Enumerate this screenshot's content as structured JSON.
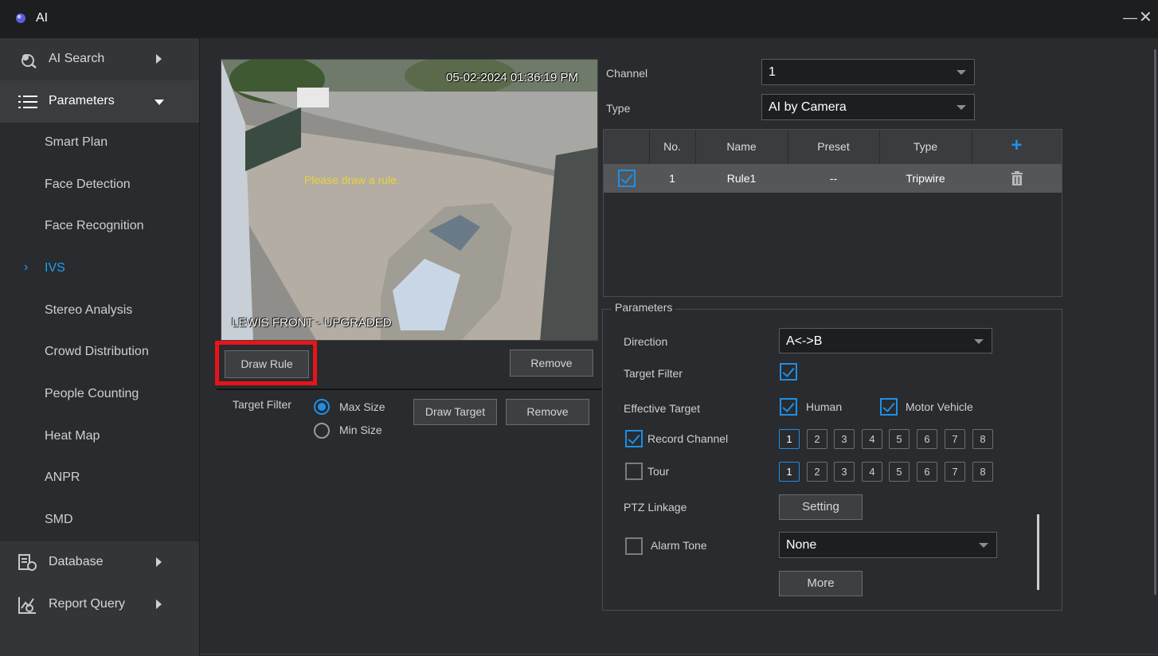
{
  "window": {
    "title": "AI",
    "minimize_glyph": "—",
    "close_glyph": "✕",
    "icon": "app-orb-icon"
  },
  "sidebar": {
    "top_items": [
      {
        "label": "AI Search",
        "icon": "ai-search-icon"
      },
      {
        "label": "Parameters",
        "icon": "list-icon"
      },
      {
        "label": "Database",
        "icon": "database-icon"
      },
      {
        "label": "Report Query",
        "icon": "report-icon"
      }
    ],
    "sub_items": [
      {
        "label": "Smart Plan"
      },
      {
        "label": "Face Detection"
      },
      {
        "label": "Face Recognition"
      },
      {
        "label": "IVS"
      },
      {
        "label": "Stereo Analysis"
      },
      {
        "label": "Crowd Distribution"
      },
      {
        "label": "People Counting"
      },
      {
        "label": "Heat Map"
      },
      {
        "label": "ANPR"
      },
      {
        "label": "SMD"
      }
    ],
    "active_sub": "IVS"
  },
  "camera": {
    "timestamp": "05-02-2024 01:36:19 PM",
    "message": "Please draw a rule.",
    "channel_name": "LEWIS FRONT - UPGRADED"
  },
  "rule_buttons": {
    "draw_rule": "Draw Rule",
    "remove": "Remove"
  },
  "target_filter": {
    "label": "Target Filter",
    "max_size": "Max Size",
    "min_size": "Min Size",
    "draw_target": "Draw Target",
    "remove": "Remove"
  },
  "form": {
    "channel_label": "Channel",
    "channel_value": "1",
    "type_label": "Type",
    "type_value": "AI by Camera"
  },
  "table": {
    "headers": [
      "No.",
      "Name",
      "Preset",
      "Type"
    ],
    "add_glyph": "+",
    "rows": [
      {
        "checked": true,
        "no": "1",
        "name": "Rule1",
        "preset": "--",
        "type": "Tripwire"
      }
    ]
  },
  "parameters": {
    "legend": "Parameters",
    "direction_label": "Direction",
    "direction_value": "A<->B",
    "target_filter_label": "Target Filter",
    "effective_target_label": "Effective Target",
    "human": "Human",
    "motor_vehicle": "Motor Vehicle",
    "record_channel_label": "Record Channel",
    "tour_label": "Tour",
    "channels": [
      "1",
      "2",
      "3",
      "4",
      "5",
      "6",
      "7",
      "8"
    ],
    "ptz_label": "PTZ Linkage",
    "setting": "Setting",
    "alarm_tone_label": "Alarm Tone",
    "alarm_tone_value": "None",
    "more": "More"
  },
  "colors": {
    "accent": "#1e8fe6",
    "highlight": "#e8141a",
    "sidebar": "#333538",
    "panel": "#292b2e"
  }
}
